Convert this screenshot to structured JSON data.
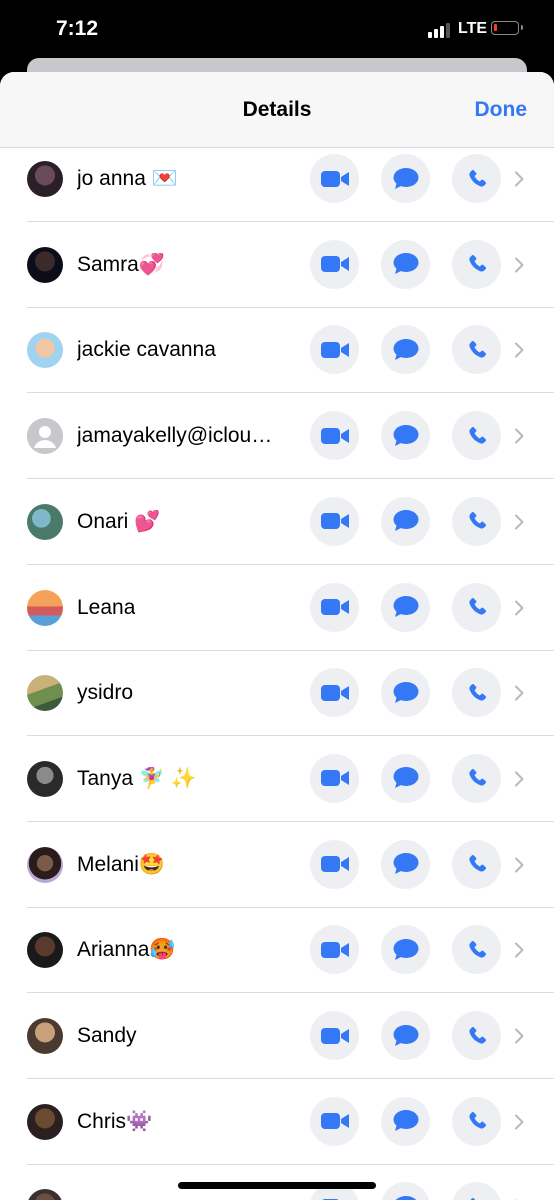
{
  "status": {
    "time": "7:12",
    "carrier": "LTE",
    "battery_color": "#ff3b30"
  },
  "nav": {
    "title": "Details",
    "done_label": "Done"
  },
  "colors": {
    "accent": "#3478f6",
    "action_bg": "#eeeff3"
  },
  "contacts": [
    {
      "name": "jo anna 💌",
      "avatar": "photo"
    },
    {
      "name": "Samra💞",
      "avatar": "photo"
    },
    {
      "name": "jackie cavanna",
      "avatar": "memoji"
    },
    {
      "name": "jamayakelly@iclou…",
      "avatar": "placeholder-person"
    },
    {
      "name": "Onari 💕",
      "avatar": "photo"
    },
    {
      "name": "Leana",
      "avatar": "photo"
    },
    {
      "name": "ysidro",
      "avatar": "photo"
    },
    {
      "name": "Tanya 🧚‍♀️ ✨",
      "avatar": "photo"
    },
    {
      "name": "Melani🤩",
      "avatar": "photo"
    },
    {
      "name": "Arianna🥵",
      "avatar": "photo"
    },
    {
      "name": "Sandy",
      "avatar": "photo"
    },
    {
      "name": "Chris👾",
      "avatar": "photo"
    },
    {
      "name": "",
      "avatar": "photo"
    }
  ],
  "row_actions": [
    "video-call-icon",
    "message-icon",
    "phone-icon",
    "chevron-right-icon"
  ]
}
